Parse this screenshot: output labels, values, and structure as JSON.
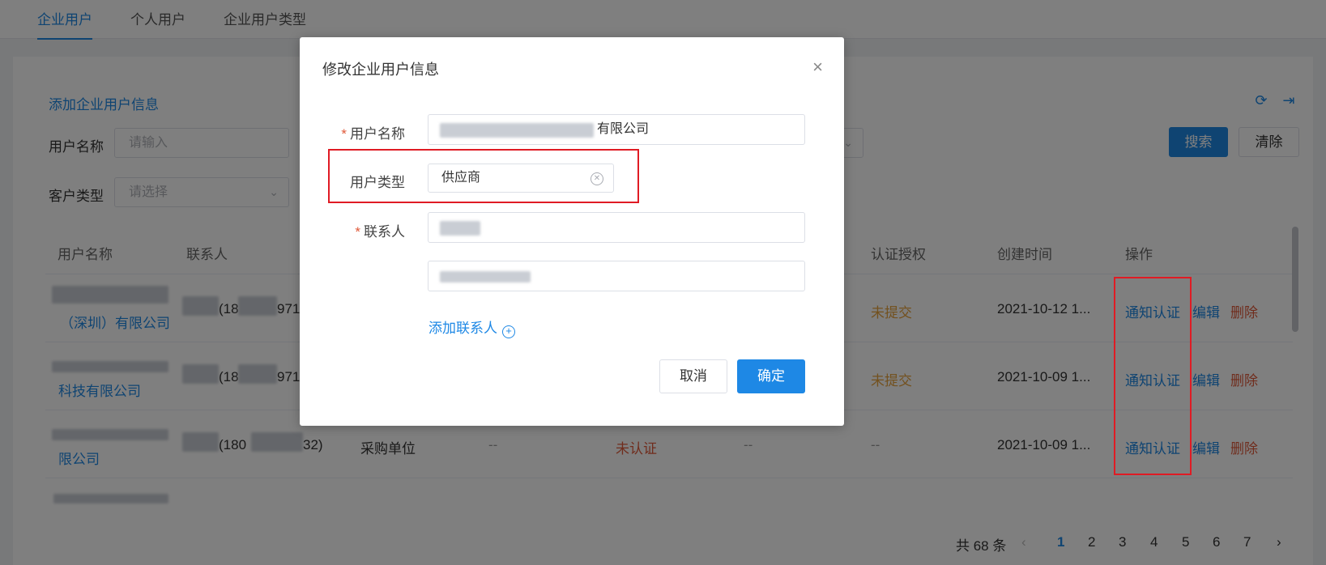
{
  "tabs": [
    {
      "label": "企业用户",
      "active": true
    },
    {
      "label": "个人用户",
      "active": false
    },
    {
      "label": "企业用户类型",
      "active": false
    }
  ],
  "toolbar": {
    "add_label": "添加企业用户信息",
    "search_label": "搜索",
    "clear_label": "清除"
  },
  "filters": {
    "username_label": "用户名称",
    "username_placeholder": "请输入",
    "customer_type_label": "客户类型",
    "customer_type_placeholder": "请选择"
  },
  "table": {
    "headers": [
      "用户名称",
      "联系人",
      "认证授权",
      "创建时间",
      "操作"
    ],
    "rows": [
      {
        "name_suffix": "（深圳）有限公司",
        "contact": "(18",
        "contact_tail": "971",
        "user_type": "",
        "col4": "",
        "cert_status": "",
        "col6": "",
        "auth": "未提交",
        "created": "2021-10-12 1...",
        "actions": [
          "通知认证",
          "编辑",
          "删除"
        ]
      },
      {
        "name_suffix": "科技有限公司",
        "contact": "(18",
        "contact_tail": "971",
        "user_type": "",
        "col4": "",
        "cert_status": "",
        "col6": "",
        "auth": "未提交",
        "created": "2021-10-09 1...",
        "actions": [
          "通知认证",
          "编辑",
          "删除"
        ]
      },
      {
        "name_suffix": "限公司",
        "contact": "(180",
        "contact_tail": "32)",
        "user_type": "采购单位",
        "col4": "--",
        "cert_status": "未认证",
        "col6": "--",
        "auth": "--",
        "created": "2021-10-09 1...",
        "actions": [
          "通知认证",
          "编辑",
          "删除"
        ]
      }
    ]
  },
  "pagination": {
    "total": "共 68 条",
    "prev": "‹",
    "pages": [
      "1",
      "2",
      "3",
      "4",
      "5",
      "6",
      "7"
    ],
    "current": "1",
    "next": "›"
  },
  "dialog": {
    "title": "修改企业用户信息",
    "close": "×",
    "required_mark": "*",
    "username_label": "用户名称",
    "username_value": "有限公司",
    "user_type_label": "用户类型",
    "user_type_value": "供应商",
    "contact_label": "联系人",
    "add_contact_label": "添加联系人",
    "cancel_label": "取消",
    "confirm_label": "确定"
  },
  "colors": {
    "accent": "#1e88e5",
    "highlight": "#e01b24",
    "warning": "#e6a23c",
    "danger": "#e05a3a"
  }
}
